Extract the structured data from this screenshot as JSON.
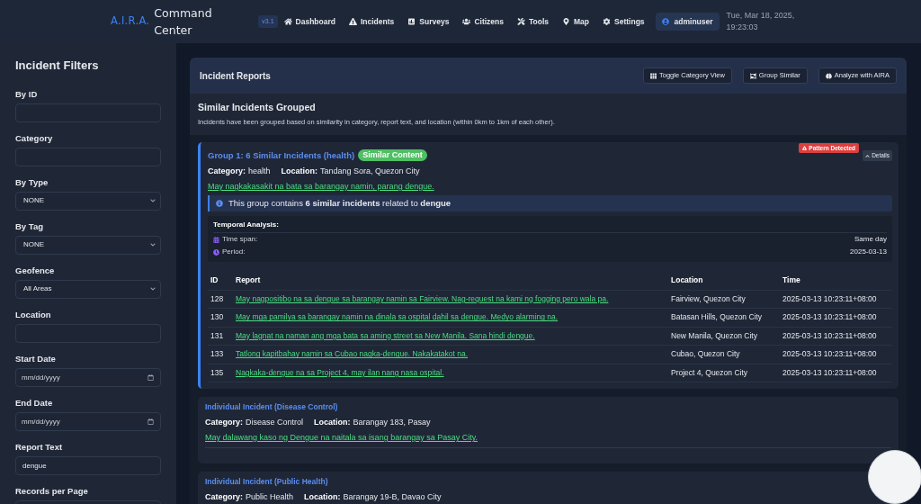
{
  "header": {
    "logo": "A.I.R.A.",
    "title": "Command Center",
    "version": "v3.1",
    "nav": [
      "Dashboard",
      "Incidents",
      "Surveys",
      "Citizens",
      "Tools",
      "Map",
      "Settings"
    ],
    "user": "adminuser",
    "datetime": "Tue, Mar 18, 2025, 19:23:03"
  },
  "sidebar": {
    "title": "Incident Filters",
    "filters": [
      {
        "label": "By ID",
        "kind": "text"
      },
      {
        "label": "Category",
        "kind": "text"
      },
      {
        "label": "By Type",
        "kind": "select",
        "value": "NONE"
      },
      {
        "label": "By Tag",
        "kind": "select",
        "value": "NONE"
      },
      {
        "label": "Geofence",
        "kind": "select",
        "value": "All Areas"
      },
      {
        "label": "Location",
        "kind": "text"
      },
      {
        "label": "Start Date",
        "kind": "date",
        "placeholder": "mm/dd/yyyy"
      },
      {
        "label": "End Date",
        "kind": "date",
        "placeholder": "mm/dd/yyyy"
      },
      {
        "label": "Report Text",
        "kind": "text",
        "value": "dengue"
      },
      {
        "label": "Records per Page",
        "kind": "text"
      }
    ]
  },
  "reports": {
    "title": "Incident Reports",
    "actions": [
      "Toggle Category View",
      "Group Similar",
      "Analyze with AIRA"
    ],
    "summary": {
      "title": "Similar Incidents Grouped",
      "description": "Incidents have been grouped based on similarity in category, report text, and location (within 0km to 1km of each other)."
    },
    "groups": [
      {
        "title": "Group 1: 6 Similar Incidents (health)",
        "badge": "Similar Content",
        "alert": "Pattern Detected",
        "details": "Details",
        "expanded": true,
        "meta": [
          {
            "label": "Category:",
            "value": "health"
          },
          {
            "label": "Location:",
            "value": "Tandang Sora, Quezon City"
          }
        ],
        "report": "May nagkakasakit na bata sa barangay namin, parang dengue.",
        "note": "This group contains **6 similar incidents** related to **dengue**",
        "temporal": {
          "title": "Temporal Analysis:",
          "rows": [
            {
              "label": "Time span:",
              "value": "Same day"
            },
            {
              "label": "Period:",
              "value": "2025-03-13"
            }
          ]
        },
        "table": {
          "columns": [
            "ID",
            "Report",
            "Location",
            "Time"
          ],
          "rows": [
            {
              "id": "128",
              "report": "May nagpositibo na sa dengue sa barangay namin sa Fairview. Nag-request na kami ng fogging pero wala pa.",
              "location": "Fairview, Quezon City",
              "time": "2025-03-13 10:23:11+08:00"
            },
            {
              "id": "130",
              "report": "May mga pamilya sa barangay namin na dinala sa ospital dahil sa dengue. Medyo alarming na.",
              "location": "Batasan Hills, Quezon City",
              "time": "2025-03-13 10:23:11+08:00"
            },
            {
              "id": "131",
              "report": "May lagnat na naman ang mga bata sa aming street sa New Manila. Sana hindi dengue.",
              "location": "New Manila, Quezon City",
              "time": "2025-03-13 10:23:11+08:00"
            },
            {
              "id": "133",
              "report": "Tatlong kapitbahay namin sa Cubao nagka-dengue. Nakakatakot na.",
              "location": "Cubao, Quezon City",
              "time": "2025-03-13 10:23:11+08:00"
            },
            {
              "id": "135",
              "report": "Nagkaka-dengue na sa Project 4, may ilan nang nasa ospital.",
              "location": "Project 4, Quezon City",
              "time": "2025-03-13 10:23:11+08:00"
            }
          ]
        }
      }
    ],
    "incidents": [
      {
        "title": "Individual Incident (Disease Control)",
        "meta": [
          {
            "label": "Category:",
            "value": "Disease Control"
          },
          {
            "label": "Location:",
            "value": "Barangay 183, Pasay"
          }
        ],
        "report": "May dalawang kaso ng Dengue na naitala sa isang barangay sa Pasay City."
      },
      {
        "title": "Individual Incident (Public Health)",
        "meta": [
          {
            "label": "Category:",
            "value": "Public Health"
          },
          {
            "label": "Location:",
            "value": "Barangay 19-B, Davao City"
          }
        ]
      }
    ]
  }
}
